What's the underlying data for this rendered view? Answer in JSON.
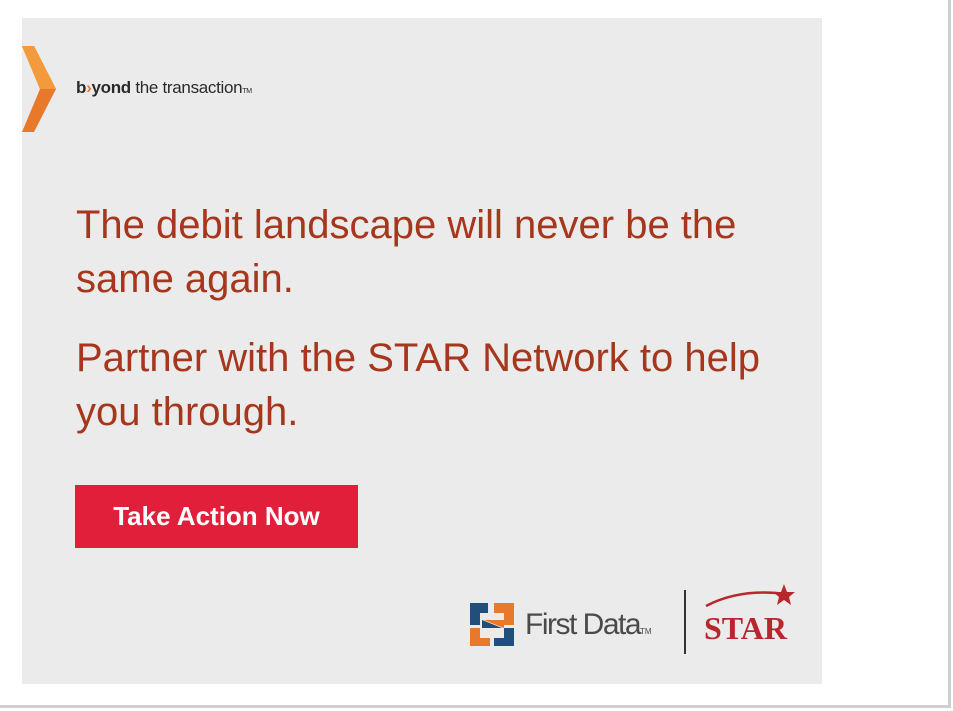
{
  "ad": {
    "tagline": {
      "b": "b",
      "yond": "yond",
      "rest": " the transaction",
      "tm": "TM"
    },
    "headline": "The debit landscape will never be the same again.",
    "subhead": "Partner with the STAR Network to help you through.",
    "cta_label": "Take Action Now",
    "partner": {
      "name": "First Data",
      "tm": "TM",
      "star_label": "STAR"
    },
    "colors": {
      "background": "#ebebeb",
      "headline": "#a6361c",
      "cta": "#e21f3a",
      "chevron": "#e8792a"
    },
    "icons": [
      "chevron-icon",
      "first-data-logo-icon",
      "star-logo-icon"
    ]
  }
}
